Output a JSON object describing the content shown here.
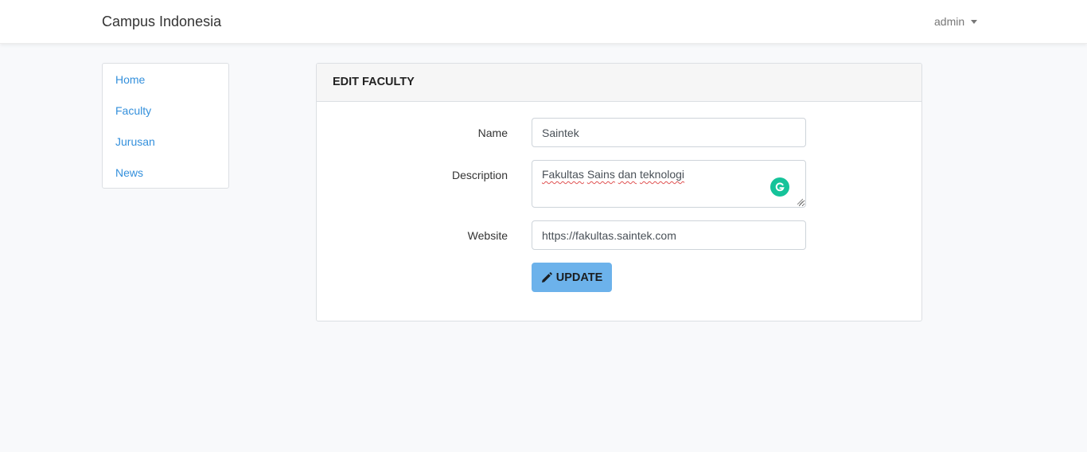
{
  "navbar": {
    "brand": "Campus Indonesia",
    "user": "admin"
  },
  "sidebar": {
    "items": [
      {
        "label": "Home"
      },
      {
        "label": "Faculty"
      },
      {
        "label": "Jurusan"
      },
      {
        "label": "News"
      }
    ]
  },
  "card": {
    "title": "EDIT FACULTY",
    "fields": {
      "name": {
        "label": "Name",
        "value": "Saintek"
      },
      "description": {
        "label": "Description",
        "value_parts": [
          "Fakultas",
          "Sains",
          "dan",
          "teknologi"
        ]
      },
      "website": {
        "label": "Website",
        "value": "https://fakultas.saintek.com"
      }
    },
    "submit_label": "UPDATE"
  },
  "colors": {
    "link": "#3490dc",
    "button": "#6cb2eb",
    "grammarly": "#15c39a",
    "background": "#f8f9fb"
  },
  "icons": [
    "caret-down-icon",
    "grammarly-icon",
    "pencil-icon"
  ]
}
